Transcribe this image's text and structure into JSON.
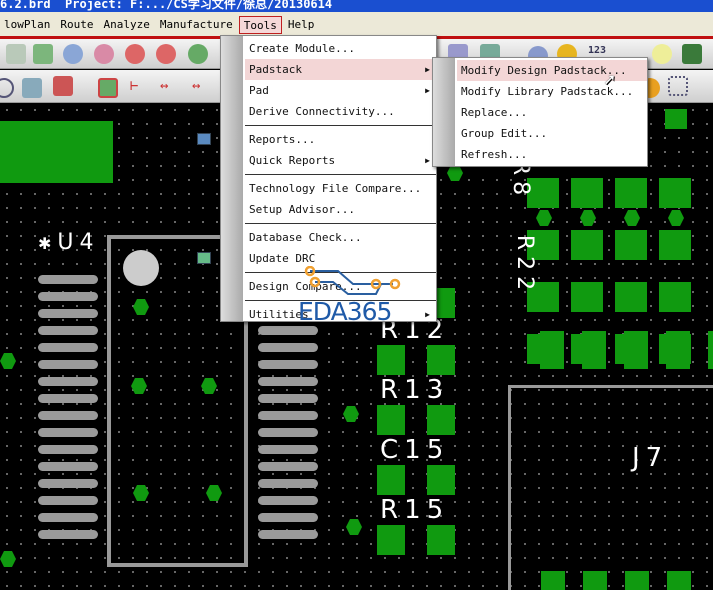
{
  "window": {
    "title": "6.2.brd  Project: F:.../CS学习文件/徐总/20130614"
  },
  "menubar": [
    "lowPlan",
    "Route",
    "Analyze",
    "Manufacture",
    "Tools",
    "Help"
  ],
  "toolbar": {
    "count_label": "123"
  },
  "tools_menu": {
    "items": [
      {
        "label": "Create Module..."
      },
      {
        "label": "Padstack",
        "submenu": true
      },
      {
        "label": "Pad",
        "submenu": true
      },
      {
        "label": "Derive Connectivity..."
      },
      {
        "label": "Reports..."
      },
      {
        "label": "Quick Reports",
        "submenu": true
      },
      {
        "label": "Technology File Compare..."
      },
      {
        "label": "Setup Advisor..."
      },
      {
        "label": "Database Check..."
      },
      {
        "label": "Update DRC"
      },
      {
        "label": "Design Compare..."
      },
      {
        "label": "Utilities",
        "submenu": true
      }
    ]
  },
  "padstack_submenu": {
    "items": [
      "Modify Design Padstack...",
      "Modify Library Padstack...",
      "Replace...",
      "Group Edit...",
      "Refresh..."
    ]
  },
  "board": {
    "labels": [
      "U4",
      "R12",
      "R13",
      "C15",
      "R15",
      "J7",
      "R8",
      "R22"
    ]
  },
  "watermark": "EDA365",
  "colors": {
    "pad": "#109a10",
    "titlebar": "#1a4fd0",
    "highlight": "#f3d6d6"
  }
}
